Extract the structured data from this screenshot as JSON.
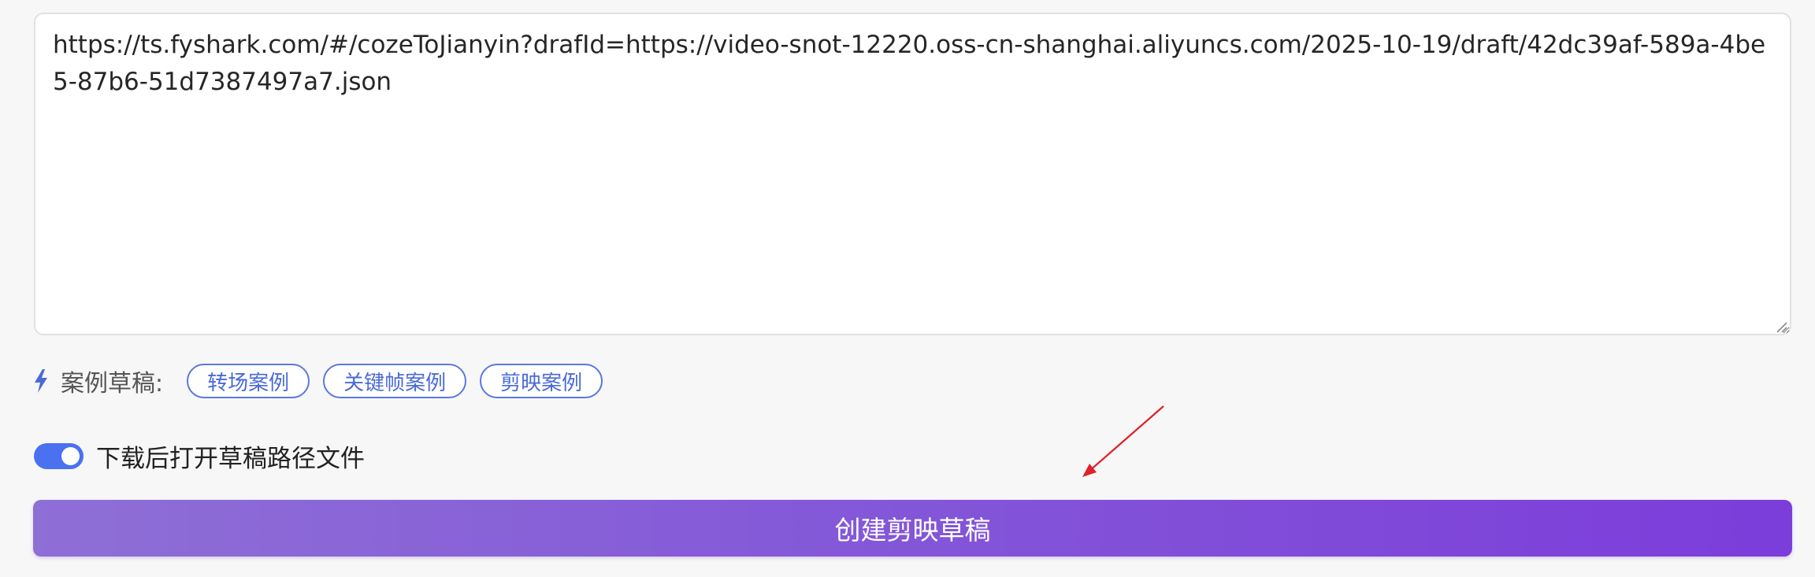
{
  "draft_input": {
    "value": "https://ts.fyshark.com/#/cozeToJianyin?drafId=https://video-snot-12220.oss-cn-shanghai.aliyuncs.com/2025-10-19/draft/42dc39af-589a-4be5-87b6-51d7387497a7.json"
  },
  "samples": {
    "label": "案例草稿:",
    "icon": "bolt-icon",
    "items": [
      {
        "label": "转场案例"
      },
      {
        "label": "关键帧案例"
      },
      {
        "label": "剪映案例"
      }
    ]
  },
  "toggle": {
    "label": "下载后打开草稿路径文件",
    "checked": true,
    "color": "#4a72f0"
  },
  "annotation": {
    "icon": "red-arrow-icon",
    "color": "#e0202a"
  },
  "create_button": {
    "label": "创建剪映草稿",
    "gradient_start": "#8e6fd6",
    "gradient_end": "#7c3dda"
  },
  "colors": {
    "background": "#f7f7f7",
    "chip_border": "#5a78e0",
    "chip_text": "#4a6ad8"
  }
}
